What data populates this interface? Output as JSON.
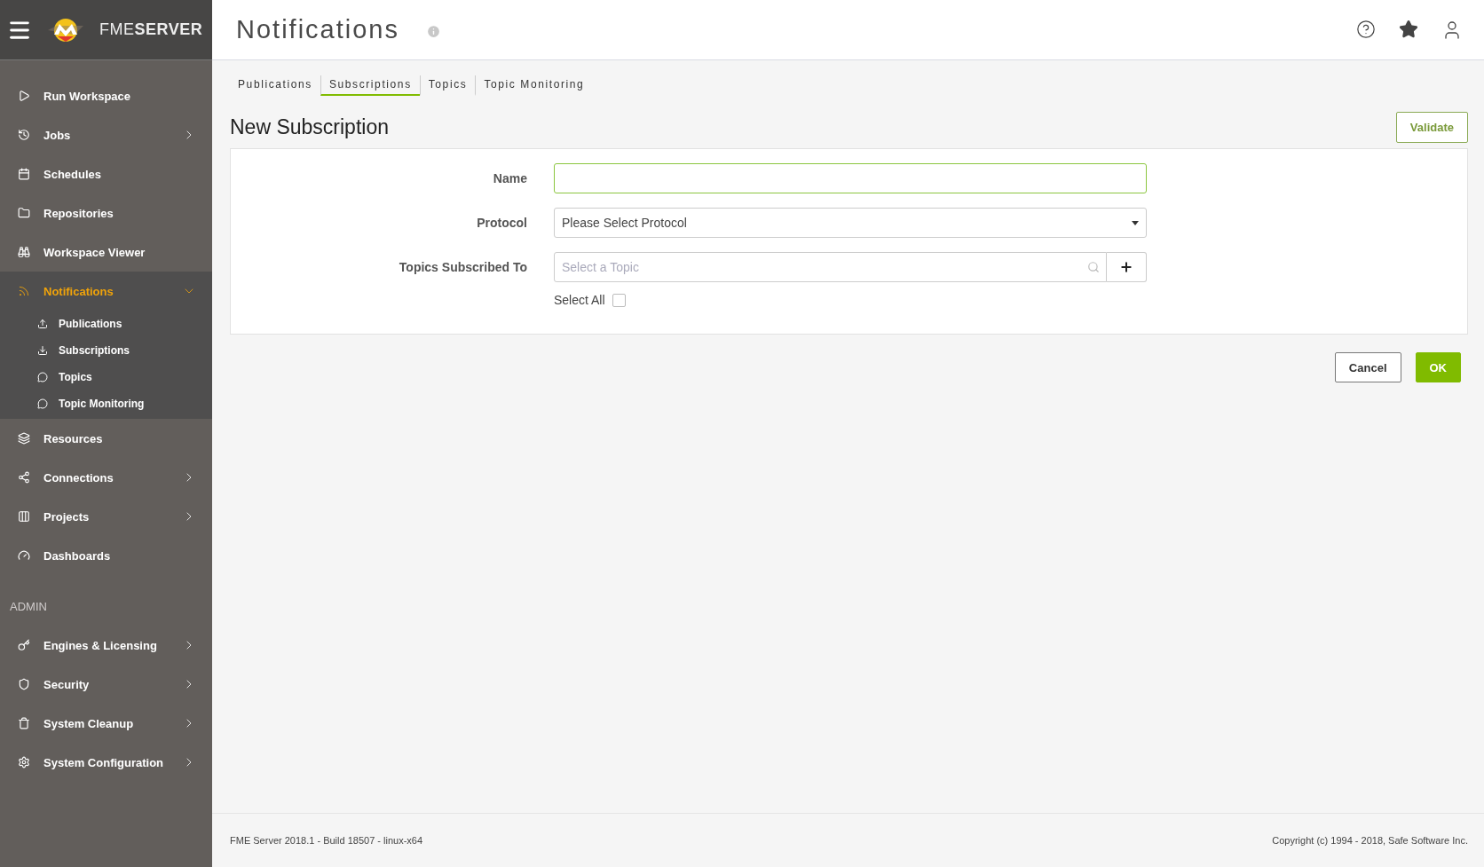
{
  "header": {
    "logo_text": "FME**SERVER**",
    "title": "Notifications"
  },
  "sidebar": {
    "items": [
      {
        "label": "Run Workspace",
        "has_submenu": false,
        "selected": false
      },
      {
        "label": "Jobs",
        "has_submenu": true,
        "expanded": false,
        "selected": false
      },
      {
        "label": "Schedules",
        "has_submenu": false,
        "selected": false
      },
      {
        "label": "Repositories",
        "has_submenu": false,
        "selected": false
      },
      {
        "label": "Workspace Viewer",
        "has_submenu": false,
        "selected": false
      },
      {
        "label": "Notifications",
        "has_submenu": true,
        "expanded": true,
        "selected": true,
        "children": [
          {
            "label": "Publications",
            "selected": false
          },
          {
            "label": "Subscriptions",
            "selected": false
          },
          {
            "label": "Topics",
            "selected": false
          },
          {
            "label": "Topic Monitoring",
            "selected": false
          }
        ]
      },
      {
        "label": "Resources",
        "has_submenu": false,
        "selected": false
      },
      {
        "label": "Connections",
        "has_submenu": true,
        "expanded": false,
        "selected": false
      },
      {
        "label": "Projects",
        "has_submenu": true,
        "expanded": false,
        "selected": false
      },
      {
        "label": "Dashboards",
        "has_submenu": false,
        "selected": false
      }
    ],
    "admin_heading": "ADMIN",
    "admin_items": [
      {
        "label": "Engines & Licensing",
        "has_submenu": true,
        "expanded": false,
        "selected": false
      },
      {
        "label": "Security",
        "has_submenu": true,
        "expanded": false,
        "selected": false
      },
      {
        "label": "System Cleanup",
        "has_submenu": true,
        "expanded": false,
        "selected": false
      },
      {
        "label": "System Configuration",
        "has_submenu": true,
        "expanded": false,
        "selected": false
      }
    ]
  },
  "tabs": [
    {
      "label": "Publications",
      "selected": false
    },
    {
      "label": "Subscriptions",
      "selected": true
    },
    {
      "label": "Topics",
      "selected": false
    },
    {
      "label": "Topic Monitoring",
      "selected": false
    }
  ],
  "form": {
    "title": "New Subscription",
    "validate_button": "Validate",
    "fields": [
      {
        "kind": "text",
        "label": "Name",
        "focused": true
      },
      {
        "kind": "select",
        "label": "Protocol",
        "value": "Please Select Protocol"
      },
      {
        "kind": "search",
        "label": "Topics Subscribed To",
        "placeholder": "Select a Topic"
      }
    ],
    "select_all": {
      "label": "Select All",
      "checked": false
    }
  },
  "buttons": [
    {
      "kind": "secondary",
      "label": "Cancel"
    },
    {
      "kind": "primary",
      "label": "OK"
    }
  ],
  "footer": {
    "version": "FME Server 2018.1 - Build 18507 - linux-x64",
    "copyright": "Copyright (c) 1994 - 2018, Safe Software Inc."
  }
}
